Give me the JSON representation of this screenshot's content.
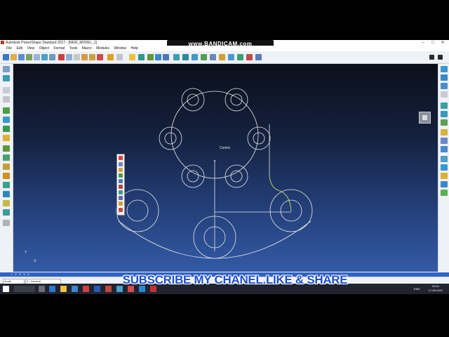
{
  "window": {
    "title": "Autodesk PowerShape Standard 2017 - [NEW_MODEL_1]",
    "controls": [
      "–",
      "□",
      "✕"
    ]
  },
  "recorder_watermark": "www.BANDICAM.com",
  "menu": {
    "items": [
      "File",
      "Edit",
      "View",
      "Object",
      "Format",
      "Tools",
      "Macro",
      "Modules",
      "Window",
      "Help"
    ]
  },
  "canvas": {
    "centre_label": "Centre",
    "axis_y": "Y",
    "axis_x": "X"
  },
  "levels": [
    "1",
    "2",
    "3",
    "4",
    "5"
  ],
  "status": {
    "field_a": "Acobl",
    "field_b": "0 : General"
  },
  "taskbar": {
    "lang": "ENG",
    "time": "20:00",
    "date": "17-06-2021"
  },
  "overlay_text": "SUBSCRIBE MY CHANEL.LIKE & SHARE",
  "colors": {
    "viewport_top": "#0b0f1a",
    "viewport_bottom": "#335aa6",
    "geometry": "#e8e8e8",
    "highlight": "#c8e25c",
    "overlay": "#1f4fd1"
  }
}
